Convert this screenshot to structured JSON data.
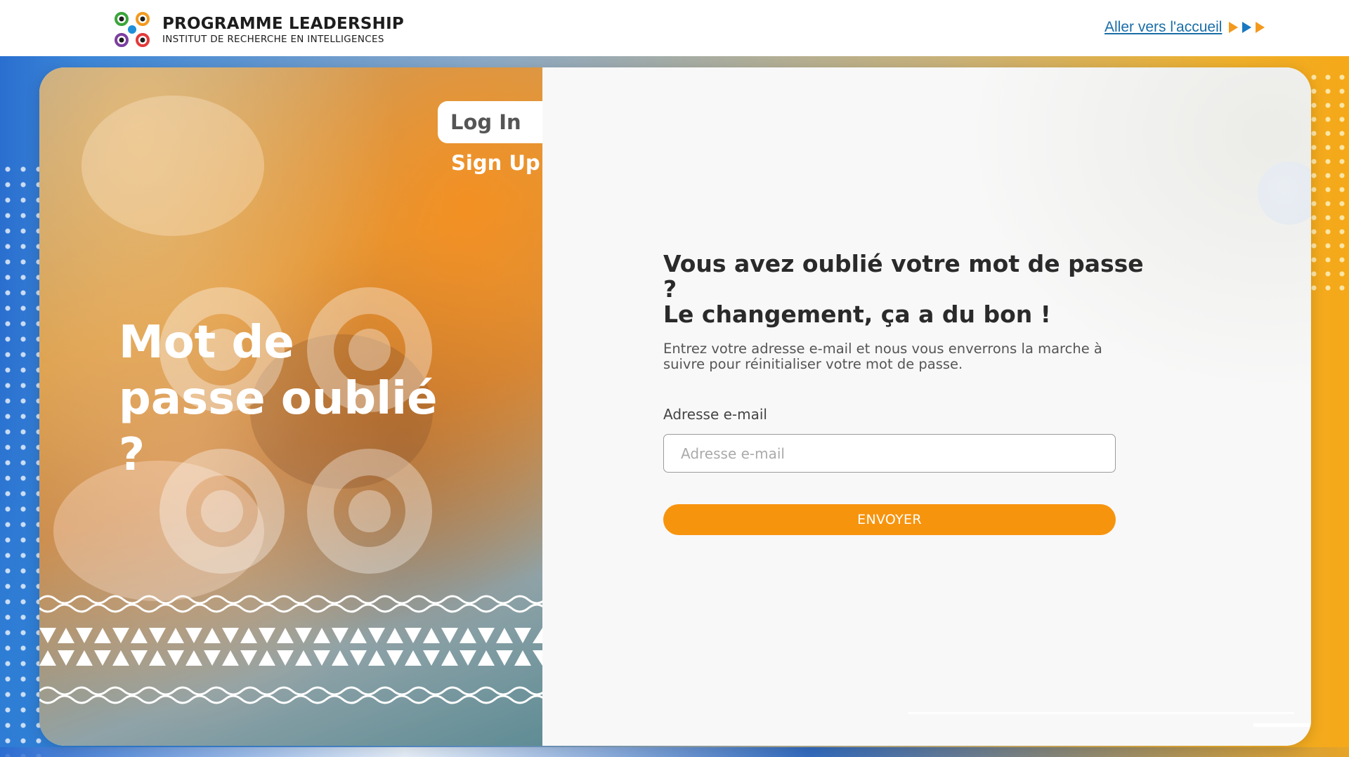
{
  "header": {
    "brand_title": "PROGRAMME LEADERSHIP",
    "brand_subtitle": "INSTITUT DE RECHERCHE EN INTELLIGENCES",
    "home_link": "Aller vers l'accueil",
    "logo_icon": "people-circle-logo-icon",
    "arrow_colors": [
      "#f39a1e",
      "#1a78c2",
      "#f39a1e"
    ]
  },
  "tabs": {
    "login": "Log In",
    "signup": "Sign Up"
  },
  "left_panel": {
    "title": "Mot de passe oublié ?"
  },
  "form": {
    "heading_line1": "Vous avez oublié votre mot de passe ?",
    "heading_line2": "Le changement, ça a du bon !",
    "description": "Entrez votre adresse e-mail et nous vous enverrons la marche à suivre pour réinitialiser votre mot de passe.",
    "email_label": "Adresse e-mail",
    "email_placeholder": "Adresse e-mail",
    "email_value": "",
    "submit_label": "ENVOYER"
  },
  "colors": {
    "accent": "#f7940e",
    "link": "#1a6ea8"
  }
}
